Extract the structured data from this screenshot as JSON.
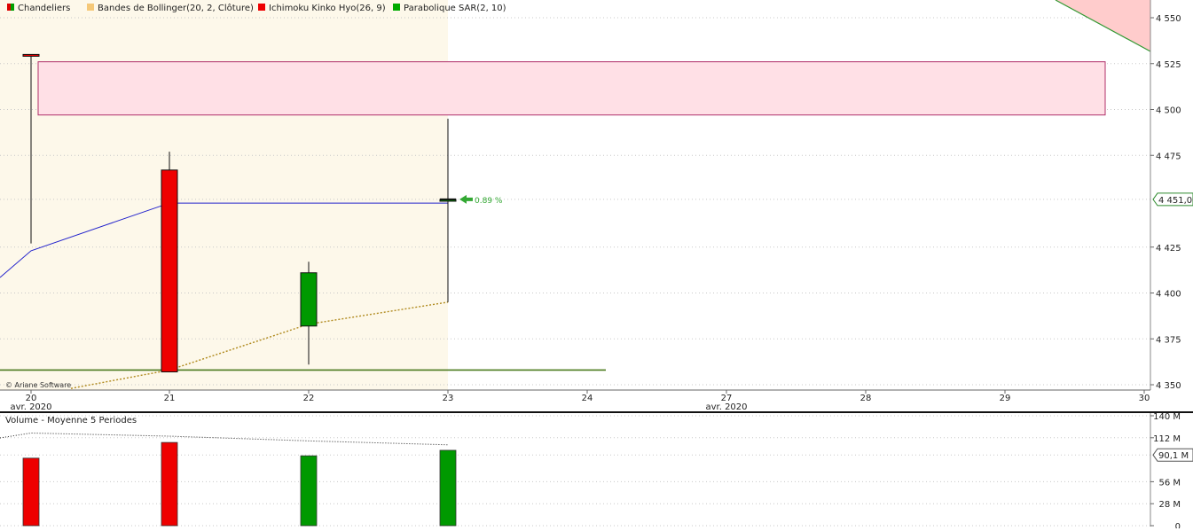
{
  "legend": [
    {
      "label": "Chandeliers",
      "color": "#dd0000",
      "color2": "#00a000"
    },
    {
      "label": "Bandes de Bollinger(20, 2, Clôture)",
      "color": "#f5c878"
    },
    {
      "label": "Ichimoku Kinko Hyo(26, 9)",
      "color": "#ee0000"
    },
    {
      "label": "Parabolique SAR(2, 10)",
      "color": "#00aa00"
    }
  ],
  "copyright": "© Ariane Software",
  "price_axis": {
    "ticks": [
      "4 550",
      "4 525",
      "4 500",
      "4 475",
      "4 451,00",
      "4 425",
      "4 400",
      "4 375",
      "4 350"
    ],
    "current_label": "4 451,00",
    "current_value": 4451
  },
  "date_axis": {
    "labels": [
      "20",
      "21",
      "22",
      "23",
      "24",
      "27",
      "28",
      "29",
      "30"
    ],
    "month_labels": [
      "avr. 2020",
      "avr. 2020"
    ]
  },
  "annotation": {
    "text": "0.89 %",
    "color": "#33a833"
  },
  "volume_panel": {
    "title": "Volume  - Moyenne 5 Periodes",
    "ticks": [
      "140 M",
      "112 M",
      "90,1 M",
      "56 M",
      "28 M",
      "0"
    ],
    "current_label": "90,1 M",
    "current_value": 90.1
  },
  "colors": {
    "up": "#009900",
    "down": "#ee0000",
    "bollinger_fill": "#fdf8ea",
    "ichimoku_cloud": "#ffe0e6",
    "ichimoku_border": "#b0306a",
    "kijun_line": "#2222cc",
    "sar_line": "#b08a1e",
    "support_line": "#4b7a1e",
    "cloud_top_fill": "#ffcccc",
    "cloud_top_line": "#339933"
  },
  "chart_data": [
    {
      "type": "candlestick",
      "x": [
        "20",
        "21",
        "22",
        "23"
      ],
      "open": [
        4530,
        4467,
        4382,
        4450
      ],
      "high": [
        4530,
        4477,
        4417,
        4495
      ],
      "low": [
        4427,
        4357,
        4361,
        4395
      ],
      "close": [
        4529,
        4357,
        4411,
        4451
      ],
      "ylim": [
        4348,
        4557
      ],
      "series": [
        {
          "name": "Ichimoku Kinko Hyo(26, 9)",
          "x": [
            "20",
            "21",
            "23"
          ],
          "values": [
            4423,
            4449,
            4449
          ]
        },
        {
          "name": "Parabolique SAR(2, 10)",
          "x": [
            "20",
            "21",
            "22",
            "23"
          ],
          "values": [
            4348,
            4358,
            4383,
            4395
          ]
        }
      ],
      "cloud": {
        "x": [
          "20",
          "29"
        ],
        "upper": 4526,
        "lower": 4497
      },
      "support_level": 4358
    },
    {
      "type": "bar",
      "categories": [
        "20",
        "21",
        "22",
        "23"
      ],
      "values": [
        86,
        106,
        89,
        96
      ],
      "moving_average": [
        118,
        114,
        108,
        103
      ],
      "ylim": [
        0,
        140
      ]
    }
  ]
}
